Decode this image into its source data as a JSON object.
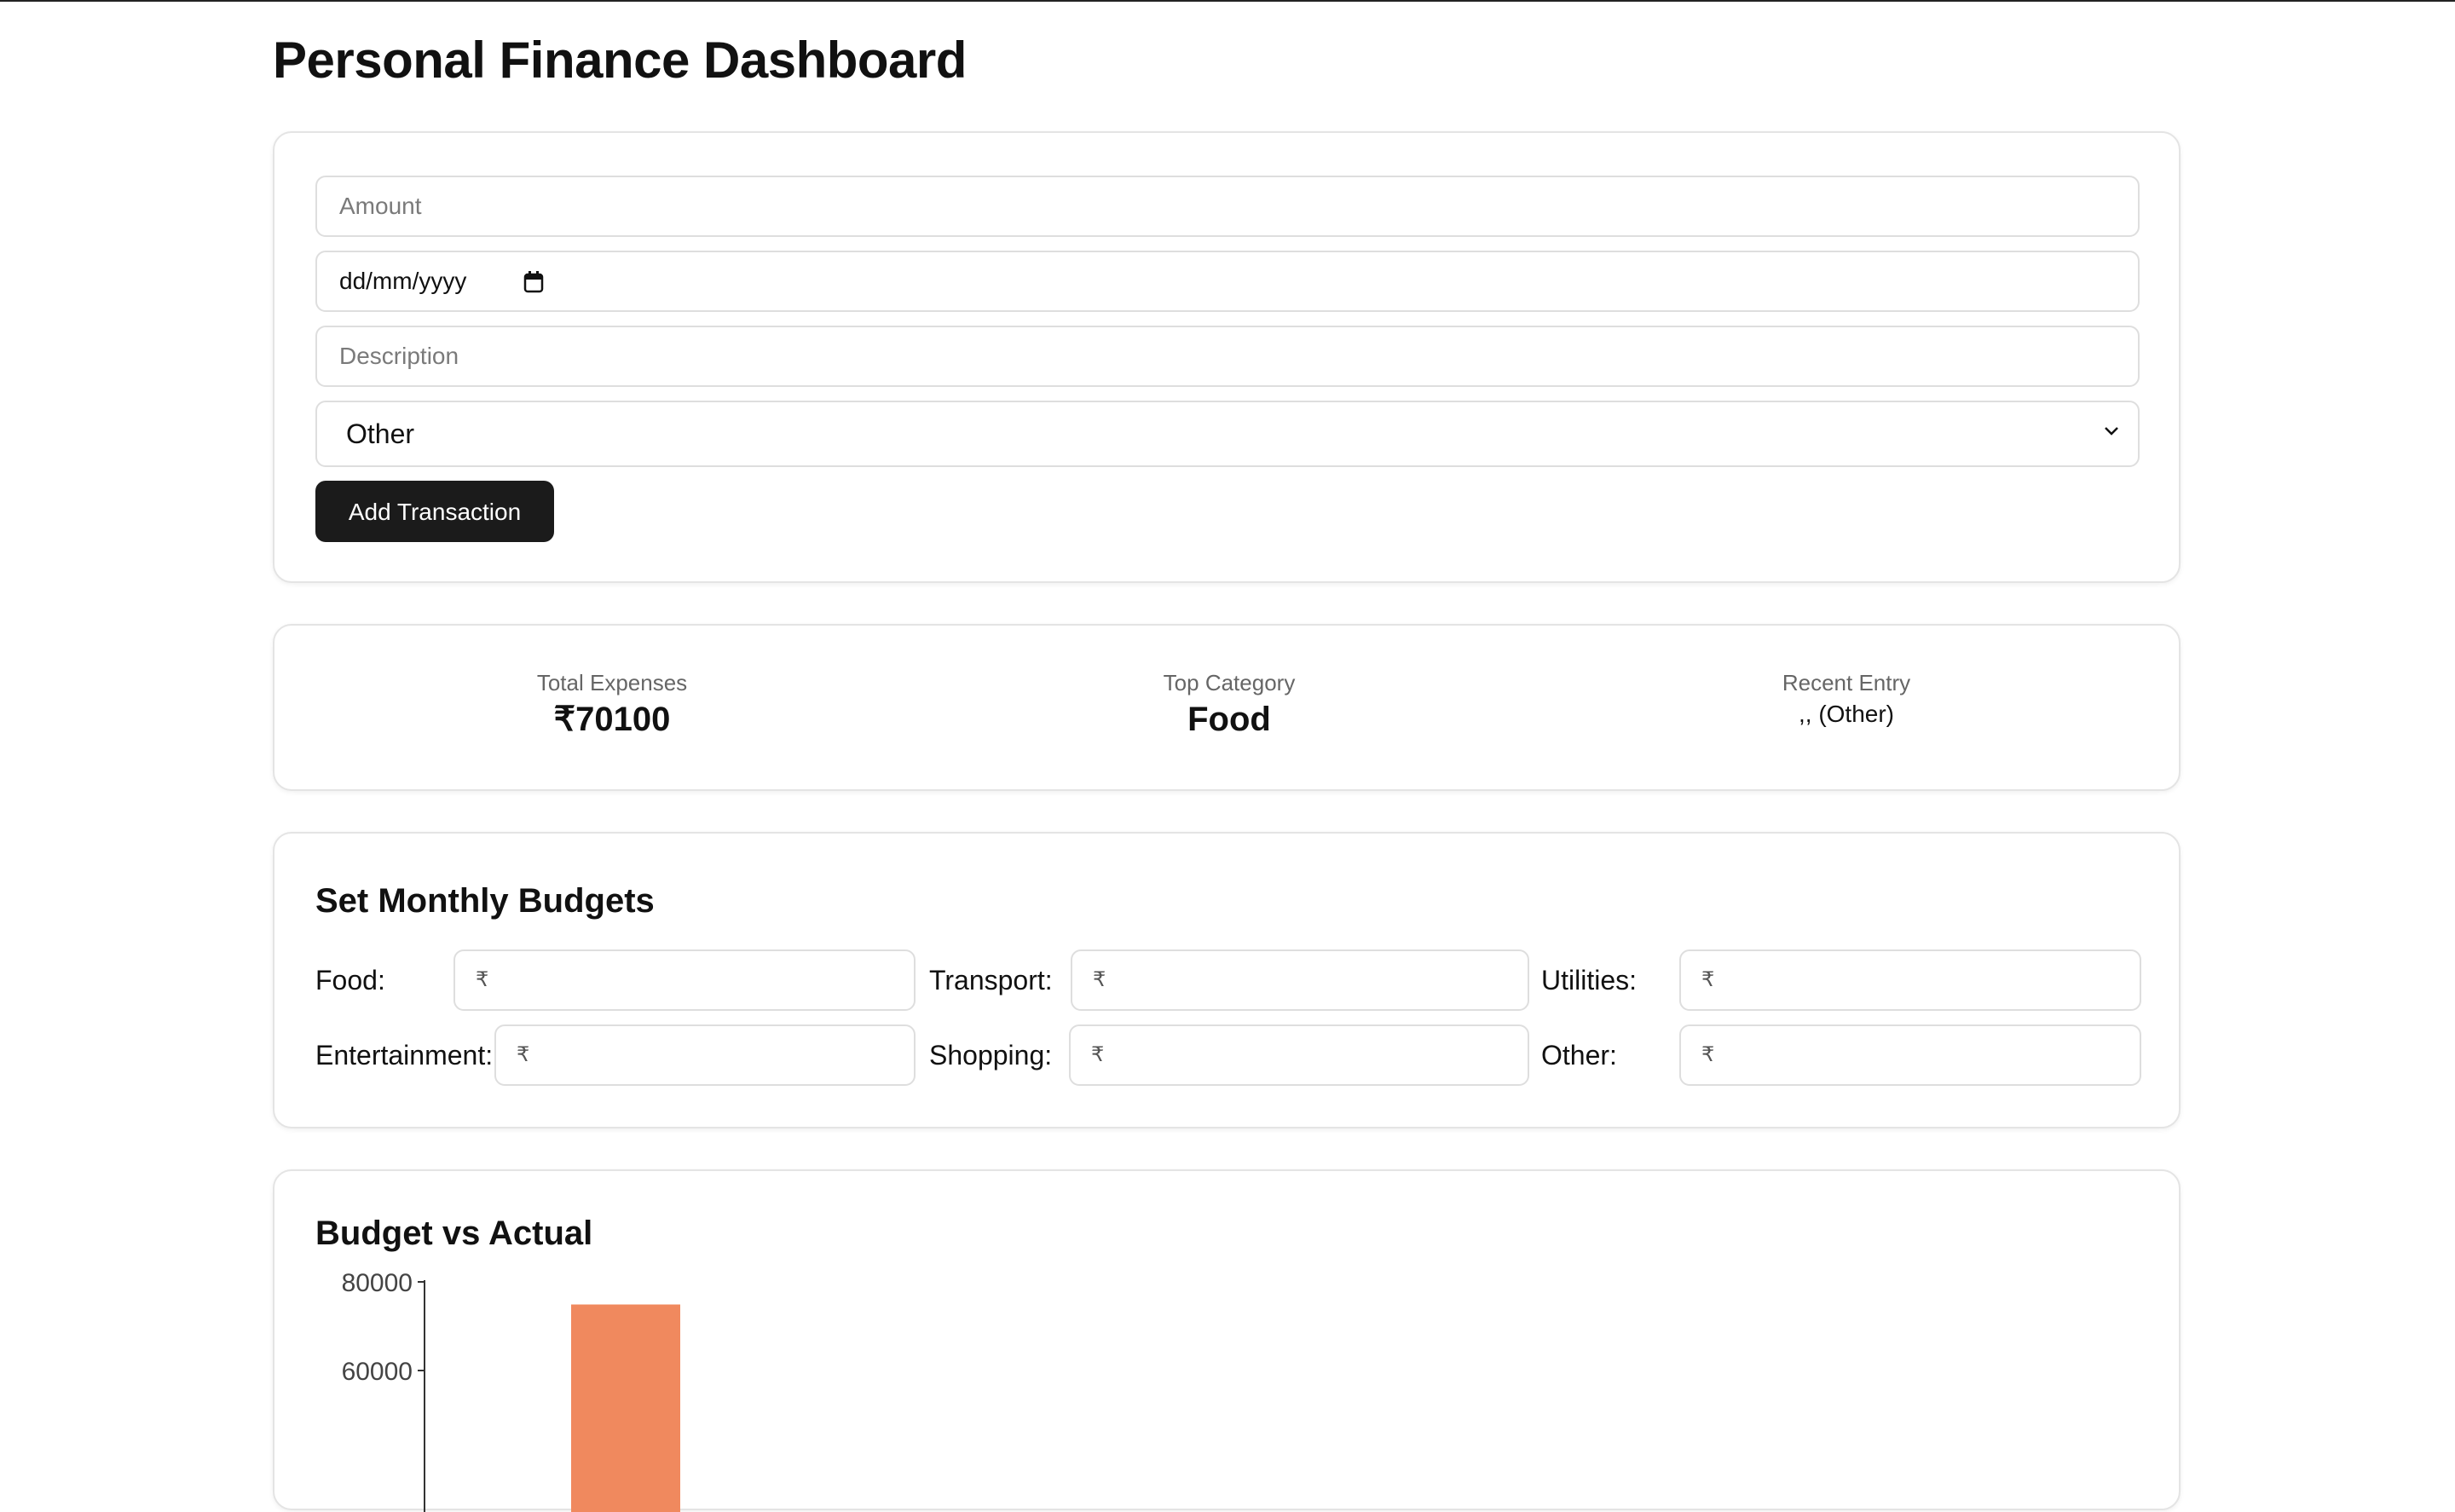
{
  "page": {
    "title": "Personal Finance Dashboard"
  },
  "transaction_form": {
    "amount_placeholder": "Amount",
    "date_placeholder": "dd/mm/yyyy",
    "description_placeholder": "Description",
    "category_selected": "Other",
    "add_button_label": "Add Transaction"
  },
  "summary": {
    "total_expenses_label": "Total Expenses",
    "total_expenses_value": "₹70100",
    "top_category_label": "Top Category",
    "top_category_value": "Food",
    "recent_entry_label": "Recent Entry",
    "recent_entry_value": ",, (Other)"
  },
  "budgets": {
    "title": "Set Monthly Budgets",
    "currency_symbol": "₹",
    "items": [
      {
        "label": "Food:"
      },
      {
        "label": "Transport:"
      },
      {
        "label": "Utilities:"
      },
      {
        "label": "Entertainment:"
      },
      {
        "label": "Shopping:"
      },
      {
        "label": "Other:"
      }
    ]
  },
  "chart_section": {
    "title": "Budget vs Actual"
  },
  "chart_data": {
    "type": "bar",
    "title": "Budget vs Actual",
    "xlabel": "",
    "ylabel": "",
    "y_ticks": [
      80000,
      60000
    ],
    "ylim": [
      60000,
      80000
    ],
    "bar_color": "#f0895e",
    "series": [
      {
        "values": [
          null,
          74900
        ]
      }
    ],
    "note_visible_portion": "only the top of the chart is visible"
  },
  "colors": {
    "primary_button": "#1b1b1b",
    "card_border": "#e4e4e4",
    "bar": "#f0895e"
  }
}
